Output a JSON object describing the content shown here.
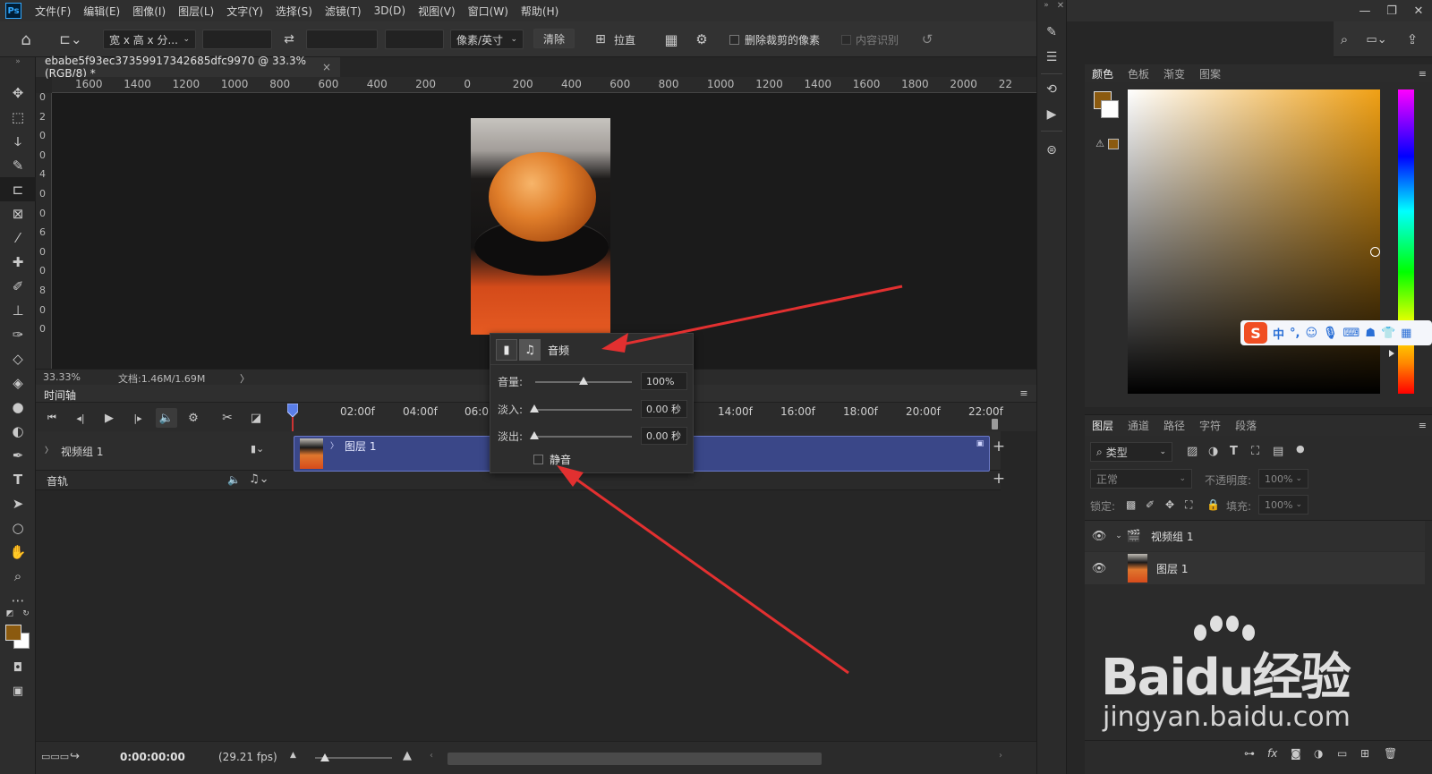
{
  "menu": {
    "logo": "Ps",
    "items": [
      "文件(F)",
      "编辑(E)",
      "图像(I)",
      "图层(L)",
      "文字(Y)",
      "选择(S)",
      "滤镜(T)",
      "3D(D)",
      "视图(V)",
      "窗口(W)",
      "帮助(H)"
    ]
  },
  "options": {
    "ratio": "宽 x 高 x 分...",
    "units": "像素/英寸",
    "clear": "清除",
    "straighten": "拉直",
    "delete_cropped": "删除裁剪的像素",
    "content_aware": "内容识别"
  },
  "document": {
    "tab_title": "ebabe5f93ec37359917342685dfc9970 @ 33.3%(RGB/8) *",
    "close": "×"
  },
  "ruler": {
    "h_ticks": [
      "1600",
      "1400",
      "1200",
      "1000",
      "800",
      "600",
      "400",
      "200",
      "0",
      "200",
      "400",
      "600",
      "800",
      "1000",
      "1200",
      "1400",
      "1600",
      "1800",
      "2000",
      "22"
    ],
    "v_ticks": [
      "0",
      "2",
      "0",
      "0",
      "4",
      "0",
      "0",
      "6",
      "0",
      "0",
      "8",
      "0",
      "0"
    ]
  },
  "status": {
    "zoom": "33.33%",
    "doc": "文档:1.46M/1.69M",
    "arrow": "〉"
  },
  "timeline": {
    "title": "时间轴",
    "time_marks": [
      "02:00f",
      "04:00f",
      "06:0",
      "14:00f",
      "16:00f",
      "18:00f",
      "20:00f",
      "22:00f"
    ],
    "video_group": "视频组 1",
    "audio_track": "音轨",
    "clip_label": "图层 1",
    "timecode": "0:00:00:00",
    "fps": "(29.21 fps)"
  },
  "audio_popup": {
    "tab_label": "音频",
    "volume_label": "音量:",
    "volume_value": "100%",
    "volume_level": 0.5,
    "fade_in_label": "淡入:",
    "fade_in_value": "0.00 秒",
    "fade_out_label": "淡出:",
    "fade_out_value": "0.00 秒",
    "mute_label": "静音"
  },
  "color_panel": {
    "tabs": [
      "颜色",
      "色板",
      "渐变",
      "图案"
    ],
    "fg_color": "#8b5a0f",
    "bg_color": "#ffffff"
  },
  "ime": {
    "logo": "S",
    "mode": "中"
  },
  "layers_panel": {
    "tabs": [
      "图层",
      "通道",
      "路径",
      "字符",
      "段落"
    ],
    "filter": "类型",
    "blend": "正常",
    "opacity_label": "不透明度:",
    "opacity_value": "100%",
    "lock_label": "锁定:",
    "fill_label": "填充:",
    "fill_value": "100%",
    "layers": [
      {
        "name": "视频组 1"
      },
      {
        "name": "图层 1"
      }
    ]
  },
  "watermark": {
    "main": "Baidu经验",
    "sub": "jingyan.baidu.com"
  }
}
